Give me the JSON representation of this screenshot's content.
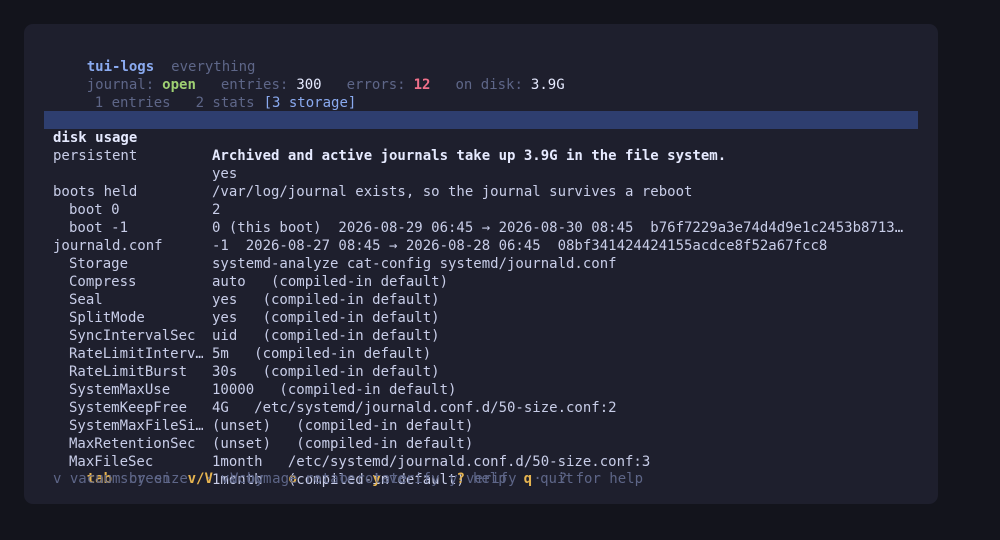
{
  "header": {
    "app_name": "tui-logs",
    "scope": "everything"
  },
  "status": {
    "journal_label": "journal:",
    "journal_value": "open",
    "entries_label": "entries:",
    "entries_value": "300",
    "errors_label": "errors:",
    "errors_value": "12",
    "disk_label": "on disk:",
    "disk_value": "3.9G"
  },
  "tabs": [
    {
      "label": "1 entries"
    },
    {
      "label": "2 stats"
    },
    {
      "label": "[3 storage]"
    }
  ],
  "rows": [
    {
      "key": "disk usage",
      "value": "Archived and active journals take up 3.9G in the file system."
    },
    {
      "key": "persistent",
      "value": "yes"
    },
    {
      "key": "",
      "value": "/var/log/journal exists, so the journal survives a reboot"
    },
    {
      "key": "boots held",
      "value": "2"
    },
    {
      "key": "boot 0",
      "value": "0 (this boot)  2026-08-29 06:45 → 2026-08-30 08:45  b76f7229a3e74d4d9e1c2453b8713…"
    },
    {
      "key": "boot -1",
      "value": "-1  2026-08-27 08:45 → 2026-08-28 06:45  08bf341424424155acdce8f52a67fcc8"
    },
    {
      "key": "journald.conf",
      "value": "systemd-analyze cat-config systemd/journald.conf"
    },
    {
      "key": "Storage",
      "value": "auto   (compiled-in default)"
    },
    {
      "key": "Compress",
      "value": "yes   (compiled-in default)"
    },
    {
      "key": "Seal",
      "value": "yes   (compiled-in default)"
    },
    {
      "key": "SplitMode",
      "value": "uid   (compiled-in default)"
    },
    {
      "key": "SyncIntervalSec",
      "value": "5m   (compiled-in default)"
    },
    {
      "key": "RateLimitInterv…",
      "value": "30s   (compiled-in default)"
    },
    {
      "key": "RateLimitBurst",
      "value": "10000   (compiled-in default)"
    },
    {
      "key": "SystemMaxUse",
      "value": "4G   /etc/systemd/journald.conf.d/50-size.conf:2"
    },
    {
      "key": "SystemKeepFree",
      "value": "(unset)   (compiled-in default)"
    },
    {
      "key": "SystemMaxFileSi…",
      "value": "(unset)   (compiled-in default)"
    },
    {
      "key": "MaxRetentionSec",
      "value": "1month   /etc/systemd/journald.conf.d/50-size.conf:3"
    },
    {
      "key": "MaxFileSec",
      "value": "1month   (compiled-in default)"
    }
  ],
  "keybar": [
    {
      "key": "tab",
      "label": "screen"
    },
    {
      "key": "v/V",
      "label": "vacuum"
    },
    {
      "key": "o",
      "label": "rotate"
    },
    {
      "key": "y",
      "label": "verify"
    },
    {
      "key": "?",
      "label": "help"
    },
    {
      "key": "q",
      "label": "quit"
    }
  ],
  "hint": "v vacuum by size  ·  V by age  ·  o rotate  ·  y verify  ·  ? for help",
  "colors": {
    "background": "#13141c",
    "panel": "#1e1f2d",
    "selection": "#2e3e6f",
    "accent_blue": "#8aaaf0",
    "ok_green": "#9ed072",
    "error_red": "#f0708a",
    "key_yellow": "#e6b450"
  }
}
